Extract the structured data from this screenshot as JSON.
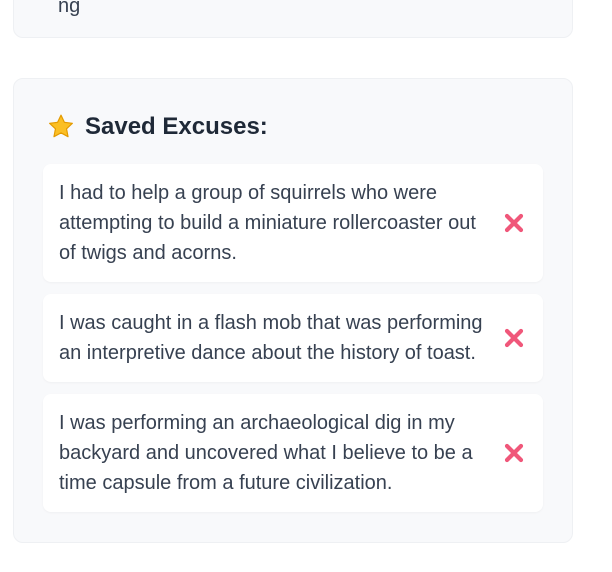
{
  "top_card": {
    "partial_text": "ng"
  },
  "saved": {
    "title": "Saved Excuses:",
    "icon": "star-icon",
    "items": [
      {
        "text": "I had to help a group of squirrels who were attempting to build a miniature rollercoaster out of twigs and acorns.",
        "remove_icon": "cross-mark-icon"
      },
      {
        "text": "I was caught in a flash mob that was performing an interpretive dance about the history of toast.",
        "remove_icon": "cross-mark-icon"
      },
      {
        "text": "I was performing an archaeological dig in my backyard and uncovered what I believe to be a time capsule from a future civilization.",
        "remove_icon": "cross-mark-icon"
      }
    ]
  },
  "colors": {
    "panel_bg": "#f8f9fb",
    "card_bg": "#ffffff",
    "text": "#374151",
    "heading": "#1f2937",
    "star": "#f5b400",
    "remove": "#f0577a"
  }
}
